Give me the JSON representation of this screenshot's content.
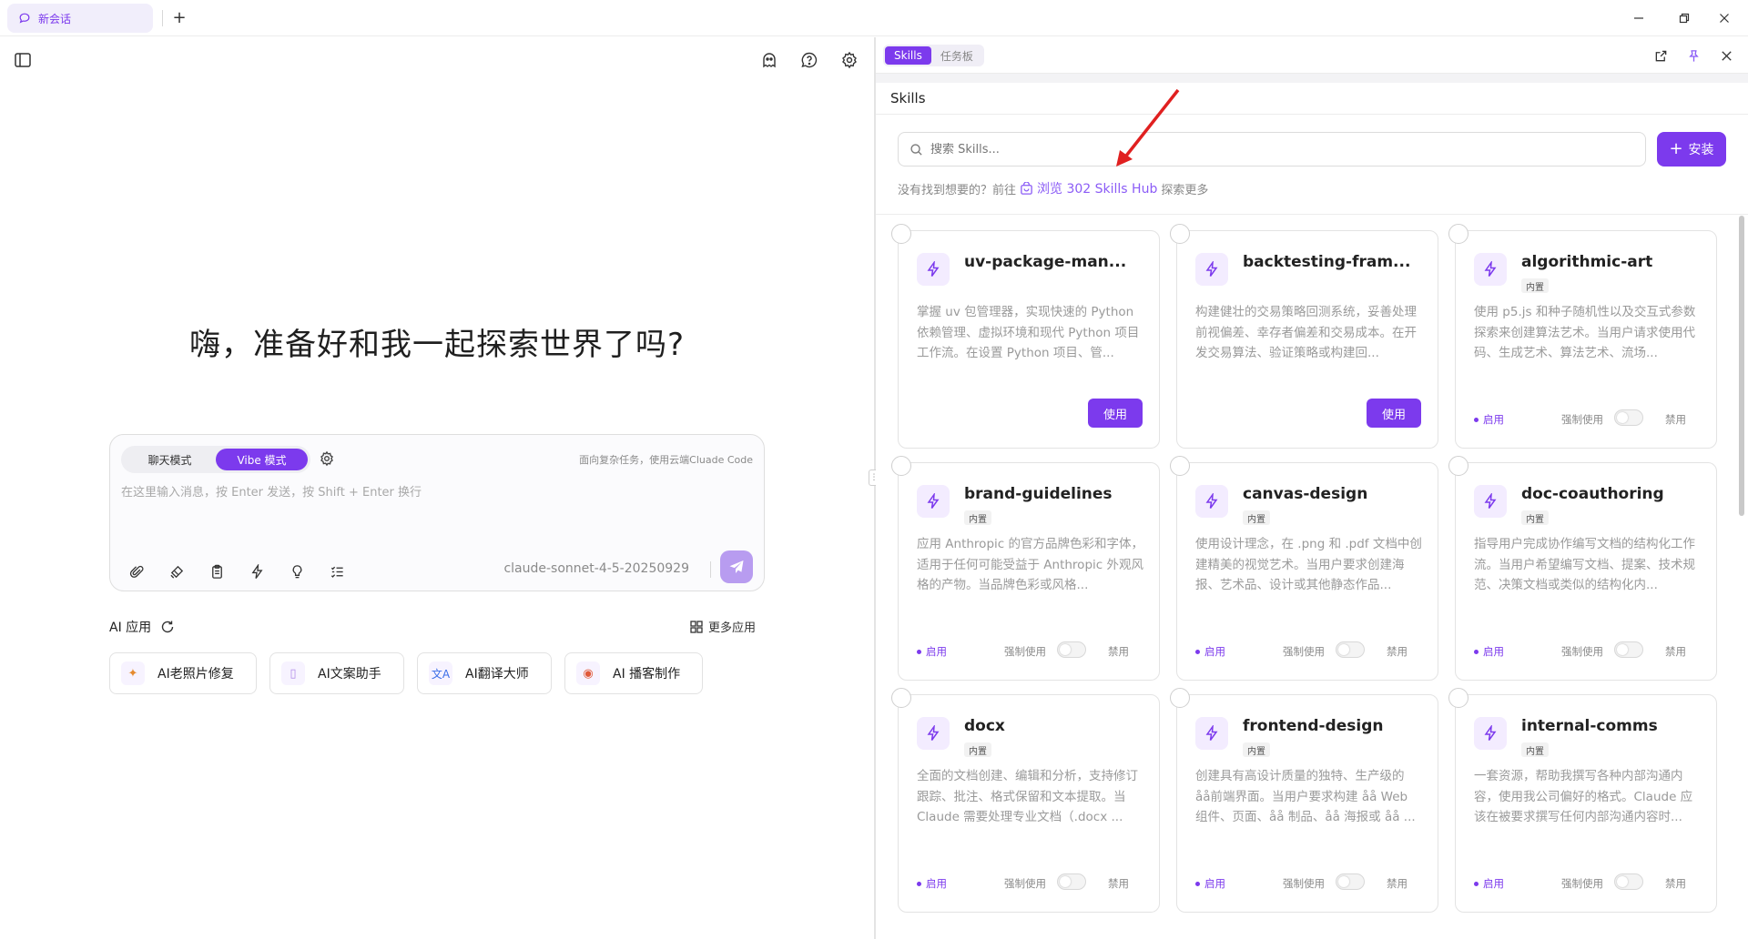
{
  "titlebar": {
    "tab_label": "新会话",
    "new_tab": "+"
  },
  "left": {
    "greeting": "嗨，准备好和我一起探索世界了吗?",
    "chatbox": {
      "mode_chat": "聊天模式",
      "mode_vibe": "Vibe 模式",
      "hint": "面向复杂任务，使用云端Cluade Code",
      "placeholder": "在这里输入消息，按 Enter 发送，按 Shift + Enter 换行",
      "model": "claude-sonnet-4-5-20250929"
    },
    "apps": {
      "title": "AI 应用",
      "more": "更多应用",
      "items": [
        {
          "label": "AI老照片修复",
          "icon": "sparkle-icon"
        },
        {
          "label": "AI文案助手",
          "icon": "document-icon"
        },
        {
          "label": "AI翻译大师",
          "icon": "translate-icon"
        },
        {
          "label": "AI 播客制作",
          "icon": "podcast-icon"
        }
      ]
    }
  },
  "right": {
    "tabs": [
      "Skills",
      "任务板"
    ],
    "section_title": "Skills",
    "search_placeholder": "搜索 Skills...",
    "install_label": "安装",
    "hint_prefix": "没有找到想要的？前往",
    "hub_link": "浏览 302 Skills Hub",
    "hint_suffix": "探索更多",
    "labels": {
      "enabled": "启用",
      "force": "强制使用",
      "disable": "禁用",
      "use": "使用"
    },
    "skills": [
      {
        "name": "uv-package-man...",
        "badge": "",
        "desc": "掌握 uv 包管理器，实现快速的 Python 依赖管理、虚拟环境和现代 Python 项目工作流。在设置 Python 项目、管...",
        "mode": "use"
      },
      {
        "name": "backtesting-fram...",
        "badge": "",
        "desc": "构建健壮的交易策略回测系统，妥善处理前视偏差、幸存者偏差和交易成本。在开发交易算法、验证策略或构建回...",
        "mode": "use"
      },
      {
        "name": "algorithmic-art",
        "badge": "内置",
        "desc": "使用 p5.js 和种子随机性以及交互式参数探索来创建算法艺术。当用户请求使用代码、生成艺术、算法艺术、流场...",
        "mode": "toggle"
      },
      {
        "name": "brand-guidelines",
        "badge": "内置",
        "desc": "应用 Anthropic 的官方品牌色彩和字体，适用于任何可能受益于 Anthropic 外观风格的产物。当品牌色彩或风格...",
        "mode": "toggle"
      },
      {
        "name": "canvas-design",
        "badge": "内置",
        "desc": "使用设计理念，在 .png 和 .pdf 文档中创建精美的视觉艺术。当用户要求创建海报、艺术品、设计或其他静态作品...",
        "mode": "toggle"
      },
      {
        "name": "doc-coauthoring",
        "badge": "内置",
        "desc": "指导用户完成协作编写文档的结构化工作流。当用户希望编写文档、提案、技术规范、决策文档或类似的结构化内...",
        "mode": "toggle"
      },
      {
        "name": "docx",
        "badge": "内置",
        "desc": "全面的文档创建、编辑和分析，支持修订跟踪、批注、格式保留和文本提取。当 Claude 需要处理专业文档（.docx ...",
        "mode": "toggle"
      },
      {
        "name": "frontend-design",
        "badge": "内置",
        "desc": "创建具有高设计质量的独特、生产级的 åå前端界面。当用户要求构建 åå Web 组件、页面、åå 制品、åå 海报或 åå ...",
        "mode": "toggle"
      },
      {
        "name": "internal-comms",
        "badge": "内置",
        "desc": "一套资源，帮助我撰写各种内部沟通内容，使用我公司偏好的格式。Claude 应该在被要求撰写任何内部沟通内容时...",
        "mode": "toggle"
      }
    ]
  },
  "colors": {
    "accent": "#7c3aed",
    "annotation_arrow": "#e02020"
  }
}
